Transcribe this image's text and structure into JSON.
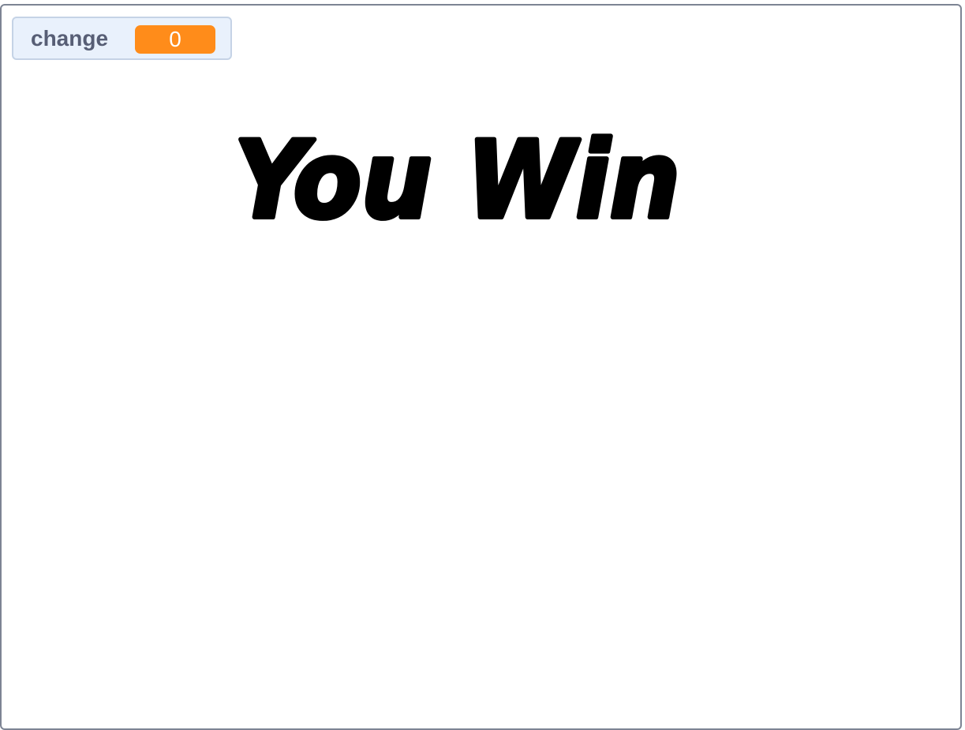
{
  "monitor": {
    "label": "change",
    "value": "0",
    "value_color": "#ff8c1a"
  },
  "sprite": {
    "text": "You Win",
    "color": "#000000"
  },
  "stage": {
    "border_color": "#7d8494",
    "background": "#ffffff"
  }
}
